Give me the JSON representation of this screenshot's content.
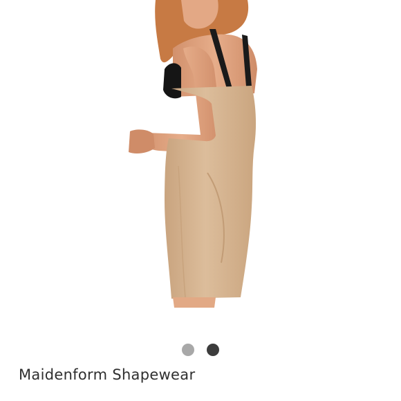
{
  "product": {
    "title": "Maidenform Shapewear",
    "image_subject": "woman-wearing-nude-shapewear-slip"
  },
  "carousel": {
    "slide_count": 2,
    "active_index": 1
  },
  "colors": {
    "background": "#ffffff",
    "dot_inactive": "#a8a8a8",
    "dot_active": "#3c3c3c",
    "title_text": "#2f2f2f",
    "garment": "#d8b896",
    "skin": "#e0a583",
    "hair": "#c97a45"
  }
}
